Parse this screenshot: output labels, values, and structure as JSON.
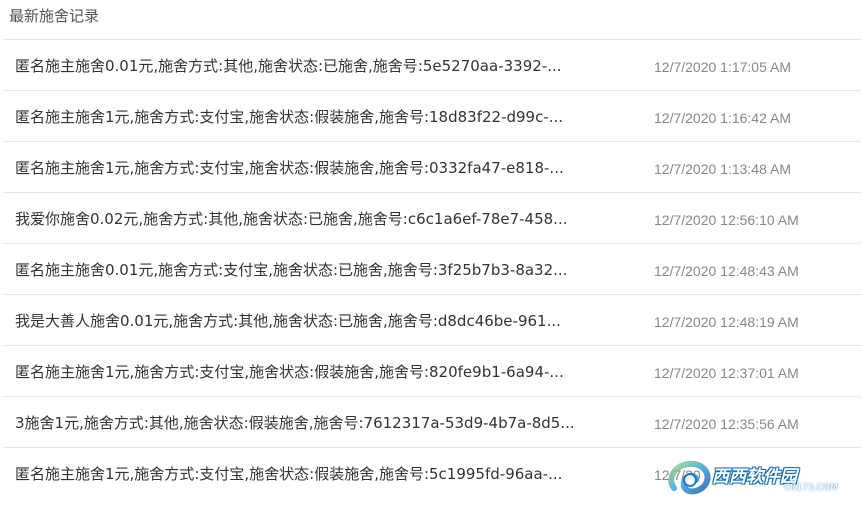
{
  "panel": {
    "title": "最新施舍记录"
  },
  "records": [
    {
      "text": "匿名施主施舍0.01元,施舍方式:其他,施舍状态:已施舍,施舍号:5e5270aa-3392-...",
      "time": "12/7/2020 1:17:05 AM"
    },
    {
      "text": "匿名施主施舍1元,施舍方式:支付宝,施舍状态:假装施舍,施舍号:18d83f22-d99c-...",
      "time": "12/7/2020 1:16:42 AM"
    },
    {
      "text": "匿名施主施舍1元,施舍方式:支付宝,施舍状态:假装施舍,施舍号:0332fa47-e818-...",
      "time": "12/7/2020 1:13:48 AM"
    },
    {
      "text": "我爱你施舍0.02元,施舍方式:其他,施舍状态:已施舍,施舍号:c6c1a6ef-78e7-458...",
      "time": "12/7/2020 12:56:10 AM"
    },
    {
      "text": "匿名施主施舍0.01元,施舍方式:支付宝,施舍状态:已施舍,施舍号:3f25b7b3-8a32...",
      "time": "12/7/2020 12:48:43 AM"
    },
    {
      "text": "我是大善人施舍0.01元,施舍方式:其他,施舍状态:已施舍,施舍号:d8dc46be-961...",
      "time": "12/7/2020 12:48:19 AM"
    },
    {
      "text": "匿名施主施舍1元,施舍方式:支付宝,施舍状态:假装施舍,施舍号:820fe9b1-6a94-...",
      "time": "12/7/2020 12:37:01 AM"
    },
    {
      "text": "3施舍1元,施舍方式:其他,施舍状态:假装施舍,施舍号:7612317a-53d9-4b7a-8d5...",
      "time": "12/7/2020 12:35:56 AM"
    },
    {
      "text": "匿名施主施舍1元,施舍方式:支付宝,施舍状态:假装施舍,施舍号:5c1995fd-96aa-...",
      "time": "12/7/20"
    }
  ],
  "watermark": {
    "main": "西西软件园",
    "sub": "CR173.COM"
  }
}
